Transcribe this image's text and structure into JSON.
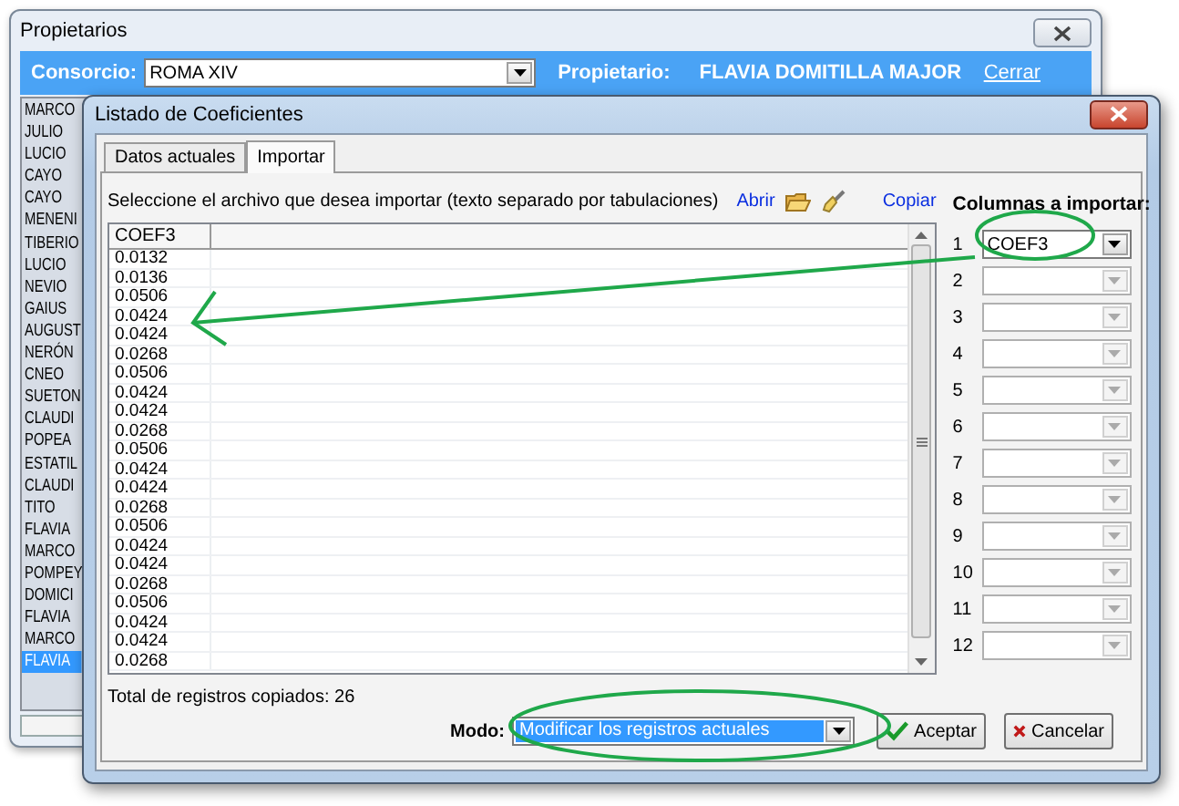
{
  "back_window": {
    "title": "Propietarios",
    "consorcio_label": "Consorcio:",
    "consorcio_value": "ROMA XIV",
    "propietario_label": "Propietario:",
    "propietario_value": "FLAVIA DOMITILLA MAJOR",
    "close_link": "Cerrar",
    "owners": [
      {
        "name": "MARCO",
        "selected": false
      },
      {
        "name": "JULIO",
        "selected": false
      },
      {
        "name": "LUCIO",
        "selected": false
      },
      {
        "name": "CAYO",
        "selected": false
      },
      {
        "name": "CAYO",
        "selected": false
      },
      {
        "name": "MENENI",
        "selected": false
      },
      {
        "name": "TIBERIO",
        "selected": false
      },
      {
        "name": "LUCIO",
        "selected": false
      },
      {
        "name": "NEVIO",
        "selected": false
      },
      {
        "name": "GAIUS",
        "selected": false
      },
      {
        "name": "AUGUST",
        "selected": false
      },
      {
        "name": "NERÓN",
        "selected": false
      },
      {
        "name": "CNEO",
        "selected": false
      },
      {
        "name": "SUETON",
        "selected": false
      },
      {
        "name": "CLAUDI",
        "selected": false
      },
      {
        "name": "POPEA",
        "selected": false
      },
      {
        "name": "ESTATIL",
        "selected": false
      },
      {
        "name": "CLAUDI",
        "selected": false
      },
      {
        "name": "TITO",
        "selected": false
      },
      {
        "name": "FLAVIA",
        "selected": false
      },
      {
        "name": "MARCO",
        "selected": false
      },
      {
        "name": "POMPEY",
        "selected": false
      },
      {
        "name": "DOMICI",
        "selected": false
      },
      {
        "name": "FLAVIA",
        "selected": false
      },
      {
        "name": "MARCO",
        "selected": false
      },
      {
        "name": "FLAVIA",
        "selected": true
      }
    ]
  },
  "dialog": {
    "title": "Listado de Coeficientes",
    "tabs": [
      {
        "label": "Datos actuales",
        "selected": false
      },
      {
        "label": "Importar",
        "selected": true
      }
    ],
    "instruction": "Seleccione el archivo que desea importar (texto separado por tabulaciones)",
    "open_link": "Abrir",
    "copy_link": "Copiar",
    "grid": {
      "columns": [
        "COEF3"
      ],
      "rows": [
        "0.0132",
        "0.0136",
        "0.0506",
        "0.0424",
        "0.0424",
        "0.0268",
        "0.0506",
        "0.0424",
        "0.0424",
        "0.0268",
        "0.0506",
        "0.0424",
        "0.0424",
        "0.0268",
        "0.0506",
        "0.0424",
        "0.0424",
        "0.0268",
        "0.0506",
        "0.0424",
        "0.0424",
        "0.0268"
      ]
    },
    "columns_panel": {
      "title": "Columnas a importar:",
      "selectors": [
        {
          "number": "1",
          "value": "COEF3",
          "disabled": false
        },
        {
          "number": "2",
          "disabled": true
        },
        {
          "number": "3",
          "disabled": true
        },
        {
          "number": "4",
          "disabled": true
        },
        {
          "number": "5",
          "disabled": true
        },
        {
          "number": "6",
          "disabled": true
        },
        {
          "number": "7",
          "disabled": true
        },
        {
          "number": "8",
          "disabled": true
        },
        {
          "number": "9",
          "disabled": true
        },
        {
          "number": "10",
          "disabled": true
        },
        {
          "number": "11",
          "disabled": true
        },
        {
          "number": "12",
          "disabled": true
        }
      ]
    },
    "total": "Total de registros copiados: 26",
    "mode_label": "Modo:",
    "mode_value": "Modificar los registros actuales",
    "buttons": [
      {
        "label": "Aceptar",
        "kind": "accept"
      },
      {
        "label": "Cancelar",
        "kind": "cancel"
      }
    ]
  }
}
